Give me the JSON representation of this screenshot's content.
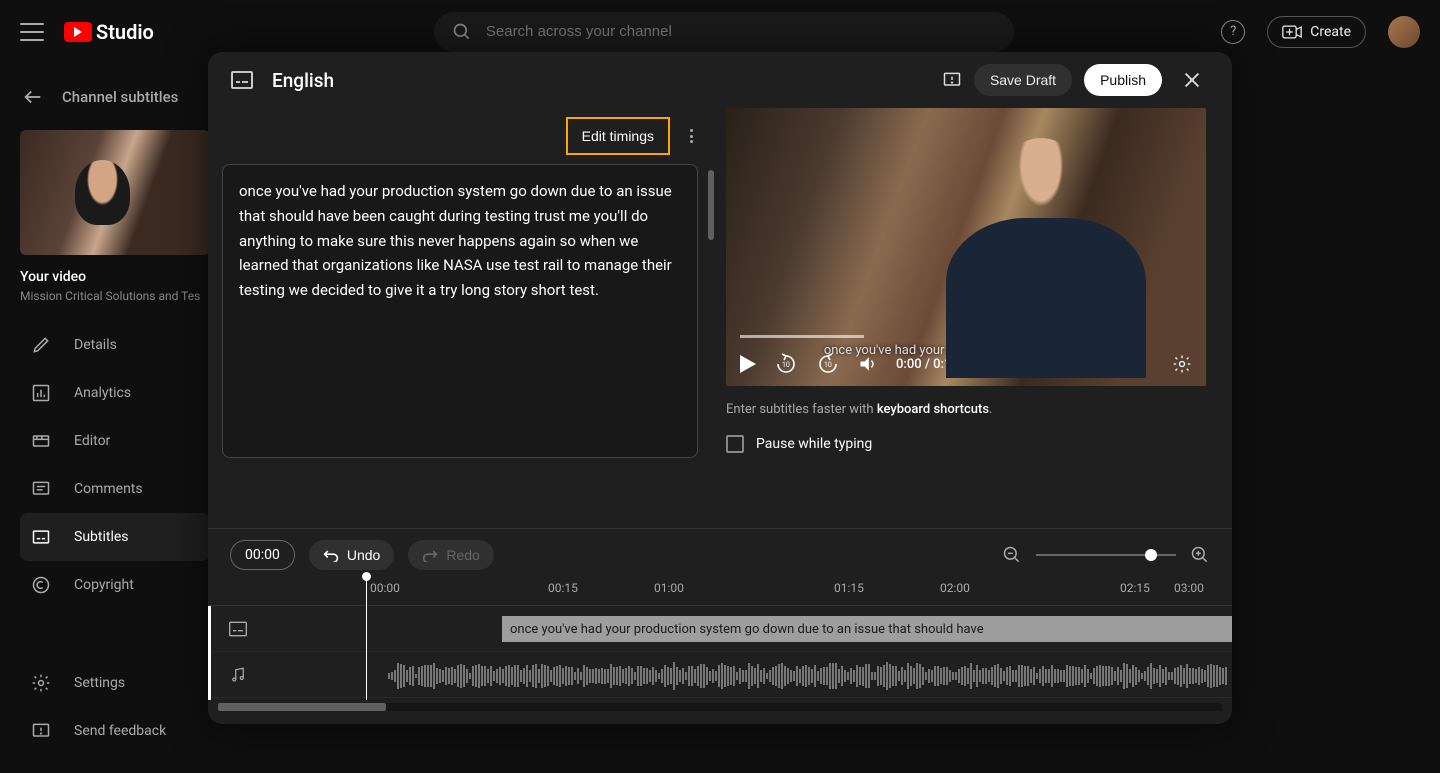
{
  "topbar": {
    "logo_text": "Studio",
    "search_placeholder": "Search across your channel",
    "create_label": "Create"
  },
  "back_row": {
    "label": "Channel subtitles"
  },
  "sidebar": {
    "video_label": "Your video",
    "video_subtitle": "Mission Critical Solutions and Tes",
    "items": [
      {
        "label": "Details"
      },
      {
        "label": "Analytics"
      },
      {
        "label": "Editor"
      },
      {
        "label": "Comments"
      },
      {
        "label": "Subtitles"
      },
      {
        "label": "Copyright"
      }
    ],
    "bottom": [
      {
        "label": "Settings"
      },
      {
        "label": "Send feedback"
      }
    ]
  },
  "modal": {
    "language": "English",
    "save_draft": "Save Draft",
    "publish": "Publish",
    "edit_timings": "Edit timings",
    "caption_text": "once you've had your production system go down due to an issue that should have been caught during testing trust me you'll do anything to make sure this never happens again so when we learned that organizations like NASA use test rail to manage their testing we decided to give it a try long story short test.",
    "video": {
      "overlay_caption": "once you've had your production system go down",
      "time": "0:00 / 0:19"
    },
    "kb_hint_prefix": "Enter subtitles faster with ",
    "kb_hint_bold": "keyboard shortcuts",
    "pause_label": "Pause while typing",
    "timeline": {
      "current_time": "00:00",
      "undo": "Undo",
      "redo": "Redo",
      "ticks": [
        "00:00",
        "00:15",
        "01:00",
        "01:15",
        "02:00",
        "02:15",
        "03:00"
      ],
      "caption_block": "once you've had your production system  go down due to an issue that should have"
    }
  }
}
